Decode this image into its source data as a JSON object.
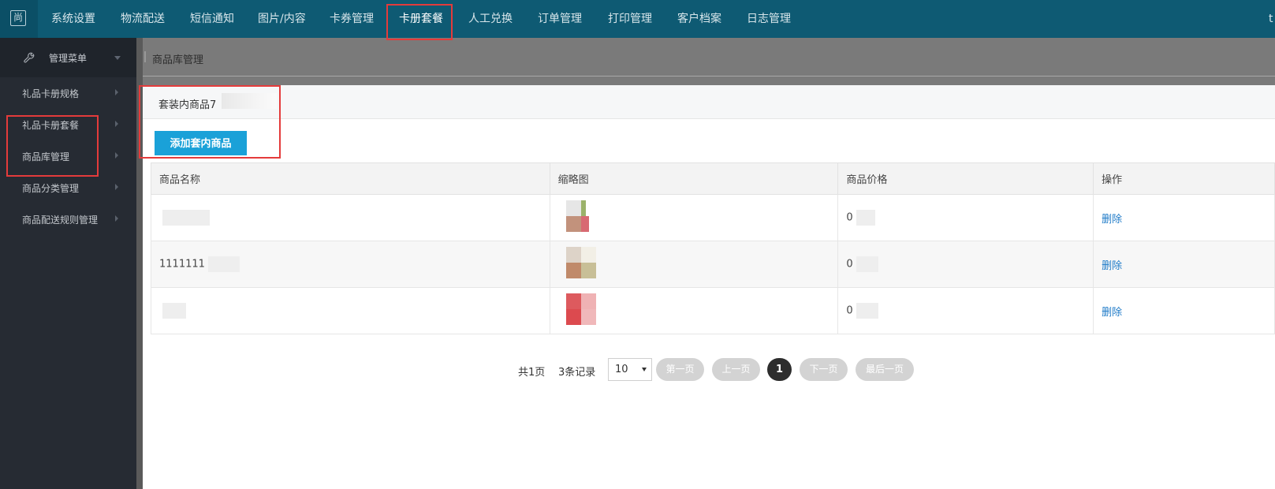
{
  "logo_glyph": "尚",
  "nav": {
    "items": [
      "系统设置",
      "物流配送",
      "短信通知",
      "图片/内容",
      "卡券管理",
      "卡册套餐",
      "人工兑换",
      "订单管理",
      "打印管理",
      "客户档案",
      "日志管理"
    ],
    "selected": "卡册套餐",
    "overflow": "t"
  },
  "sidebar": {
    "header": "管理菜单",
    "items": [
      "礼品卡册规格",
      "礼品卡册套餐",
      "商品库管理",
      "商品分类管理",
      "商品配送规则管理"
    ]
  },
  "breadcrumb": "商品库管理",
  "dialog": {
    "title": "套装内商品7",
    "add_button": "添加套内商品"
  },
  "table": {
    "headers": [
      "商品名称",
      "缩略图",
      "商品价格",
      "操作"
    ],
    "rows": [
      {
        "name": "",
        "price": "0",
        "action": "删除"
      },
      {
        "name": "1111111",
        "price": "0",
        "action": "删除"
      },
      {
        "name": "",
        "price": "0",
        "action": "删除"
      }
    ]
  },
  "pager": {
    "total_pages": "共1页",
    "total_records": "3条记录",
    "page_size": "10",
    "first": "第一页",
    "prev": "上一页",
    "current": "1",
    "next": "下一页",
    "last": "最后一页"
  },
  "colors": {
    "topbar": "#0e5a73",
    "sidebar": "#262b33",
    "accent_button": "#1aa1d8",
    "highlight": "#e43b3b",
    "link": "#1f7bc8"
  }
}
